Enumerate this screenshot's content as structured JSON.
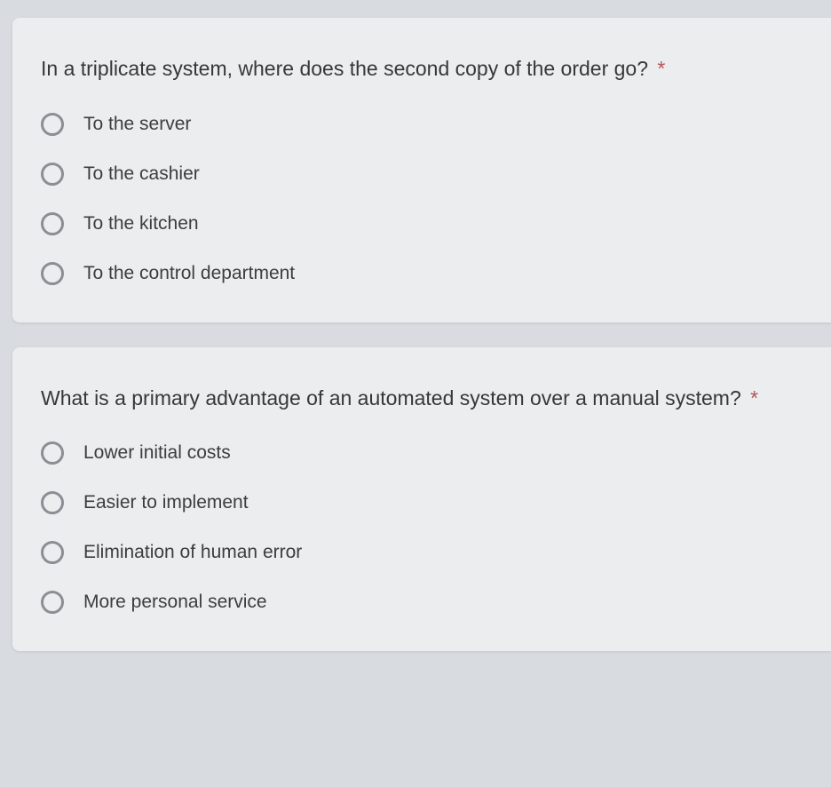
{
  "questions": [
    {
      "text": "In a triplicate system, where does the second copy of the order go?",
      "required": "*",
      "options": [
        "To the server",
        "To the cashier",
        "To the kitchen",
        "To the control department"
      ]
    },
    {
      "text": "What is a primary advantage of an automated system over a manual system?",
      "required": "*",
      "options": [
        "Lower initial costs",
        "Easier to implement",
        "Elimination of human error",
        "More personal service"
      ]
    }
  ]
}
